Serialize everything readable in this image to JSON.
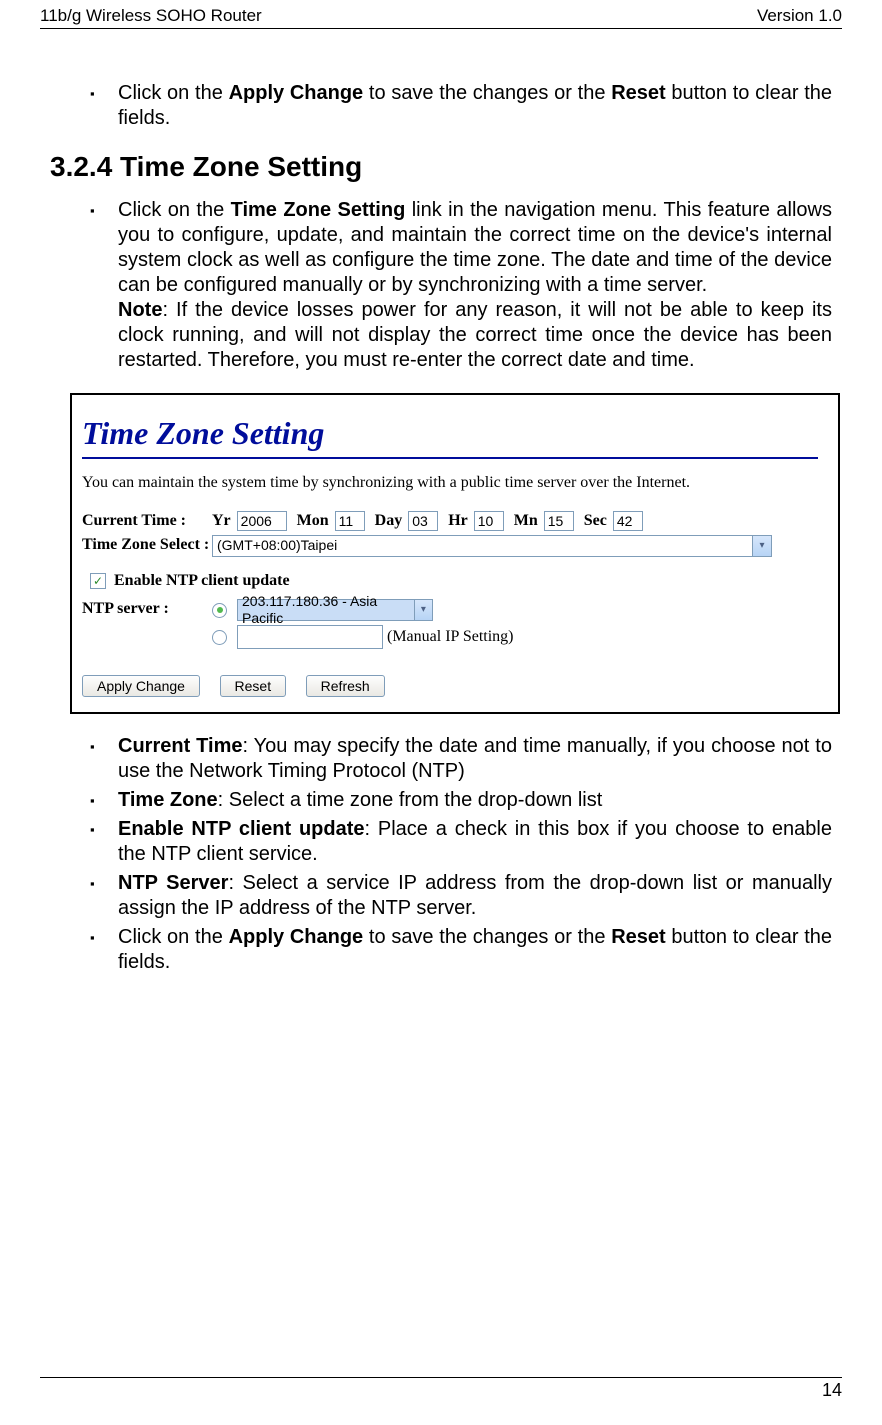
{
  "header": {
    "left": "11b/g Wireless SOHO Router",
    "right": "Version 1.0"
  },
  "intro_bullet": {
    "pre": "Click on the ",
    "b1": "Apply Change",
    "mid": " to save the changes or the ",
    "b2": "Reset",
    "post": " button to clear the fields."
  },
  "section_heading": "3.2.4  Time Zone Setting",
  "tz_bullet": {
    "pre": "Click on the ",
    "link": "Time Zone Setting",
    "body": " link in the navigation menu. This feature allows you to configure, update, and maintain the correct time on the device's internal system clock as well as configure the time zone.  The date and time of the device can be configured manually or by synchronizing with a time server.",
    "note_label": "Note",
    "note_body": ": If the device losses power for any reason, it will not be able to keep its clock running, and will not display the correct time once the device has been restarted. Therefore, you must re-enter the correct date and time."
  },
  "screenshot": {
    "title": "Time Zone Setting",
    "desc": "You can maintain the system time by synchronizing with a public time server over the Internet.",
    "current_time_label": "Current Time :",
    "yr_label": "Yr",
    "yr_val": "2006",
    "mon_label": "Mon",
    "mon_val": "11",
    "day_label": "Day",
    "day_val": "03",
    "hr_label": "Hr",
    "hr_val": "10",
    "mn_label": "Mn",
    "mn_val": "15",
    "sec_label": "Sec",
    "sec_val": "42",
    "tz_label": "Time Zone Select :",
    "tz_value": "(GMT+08:00)Taipei",
    "enable_ntp_label": "Enable NTP client update",
    "ntp_server_label": "NTP server :",
    "ntp_select_value": "203.117.180.36 - Asia Pacific",
    "manual_ip_label": "(Manual IP Setting)",
    "btn_apply": "Apply Change",
    "btn_reset": "Reset",
    "btn_refresh": "Refresh"
  },
  "desc_bullets": {
    "ct_label": "Current Time",
    "ct_body": ": You may specify the date and time manually, if you choose not to use the Network Timing Protocol (NTP)",
    "tz_label": "Time Zone",
    "tz_body": ": Select a time zone from the drop-down list",
    "ntp_label": "Enable NTP client update",
    "ntp_body": ": Place a check in this box if you choose to enable the NTP client service.",
    "srv_label": "NTP Server",
    "srv_body": ": Select a service IP address from the drop-down list or manually assign the IP address of the NTP server.",
    "apply_pre": "Click on the ",
    "apply_b1": "Apply Change",
    "apply_mid": " to save the changes or the ",
    "apply_b2": "Reset",
    "apply_post": " button to clear the fields."
  },
  "page_number": "14"
}
